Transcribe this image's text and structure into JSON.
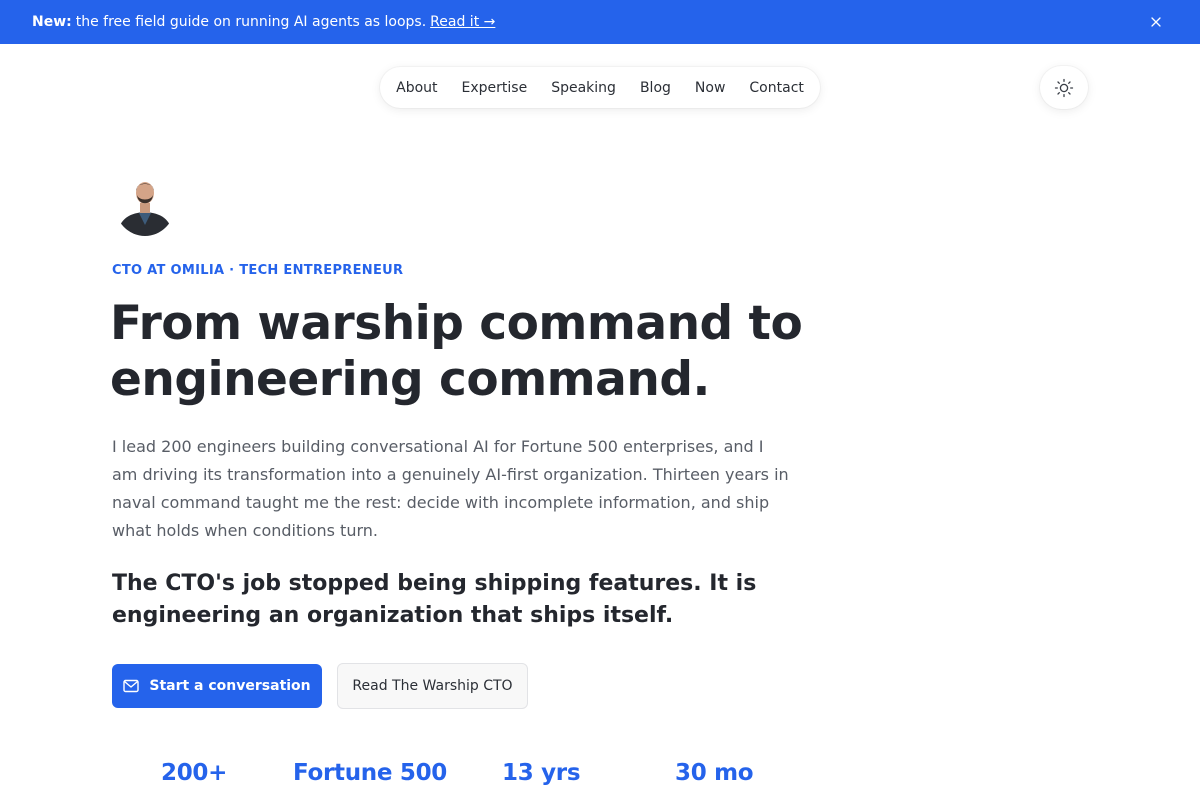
{
  "banner": {
    "prefix": "New:",
    "text": "the free field guide on running AI agents as loops.",
    "link": "Read it →",
    "close_icon": "close-icon"
  },
  "nav": {
    "items": [
      {
        "label": "About"
      },
      {
        "label": "Expertise"
      },
      {
        "label": "Speaking"
      },
      {
        "label": "Blog"
      },
      {
        "label": "Now"
      },
      {
        "label": "Contact"
      }
    ]
  },
  "theme_toggle": {
    "icon": "sun-icon"
  },
  "hero": {
    "eyebrow": "CTO AT OMILIA · TECH ENTREPRENEUR",
    "headline_line1": "From warship command to",
    "headline_line2": "engineering command.",
    "lead": "I lead 200 engineers building conversational AI for Fortune 500 enterprises, and I am driving its transformation into a genuinely AI-first organization. Thirteen years in naval command taught me the rest: decide with incomplete information, and ship what holds when conditions turn.",
    "thesis": "The CTO's job stopped being shipping features. It is engineering an organization that ships itself.",
    "primary_button": "Start a conversation",
    "secondary_button": "Read The Warship CTO"
  },
  "stats": [
    {
      "value": "200+"
    },
    {
      "value": "Fortune 500"
    },
    {
      "value": "13 yrs"
    },
    {
      "value": "30 mo"
    }
  ],
  "colors": {
    "accent": "#2563eb",
    "text": "#24272e",
    "muted": "#585d66"
  }
}
